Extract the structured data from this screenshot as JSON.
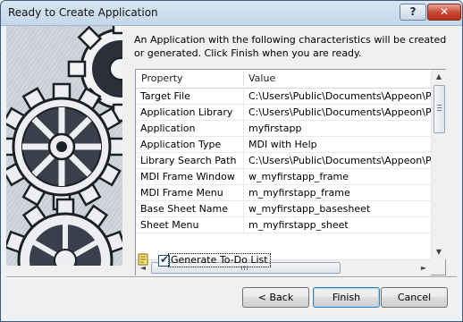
{
  "window": {
    "title": "Ready to Create Application"
  },
  "titlebar": {
    "help_label": "?",
    "close_label": "✕"
  },
  "intro_text": "An Application with the following characteristics will be created or generated.  Click Finish when you are ready.",
  "table": {
    "columns": [
      "Property",
      "Value"
    ],
    "rows": [
      {
        "property": "Target File",
        "value": "C:\\Users\\Public\\Documents\\Appeon\\Power"
      },
      {
        "property": "Application Library",
        "value": "C:\\Users\\Public\\Documents\\Appeon\\Power"
      },
      {
        "property": "Application",
        "value": "myfirstapp"
      },
      {
        "property": "Application Type",
        "value": "MDI with Help"
      },
      {
        "property": "Library Search Path",
        "value": "C:\\Users\\Public\\Documents\\Appeon\\Power"
      },
      {
        "property": "MDI Frame Window",
        "value": "w_myfirstapp_frame"
      },
      {
        "property": "MDI Frame Menu",
        "value": "m_myfirstapp_frame"
      },
      {
        "property": "Base Sheet Name",
        "value": "w_myfirstapp_basesheet"
      },
      {
        "property": "Sheet Menu",
        "value": "m_myfirstapp_sheet"
      }
    ]
  },
  "scroll": {
    "up": "▲",
    "down": "▼",
    "left": "◄",
    "right": "►"
  },
  "todo": {
    "label": "Generate To-Do List",
    "checked": true,
    "check_glyph": "✔"
  },
  "buttons": {
    "back": "< Back",
    "finish": "Finish",
    "cancel": "Cancel"
  }
}
